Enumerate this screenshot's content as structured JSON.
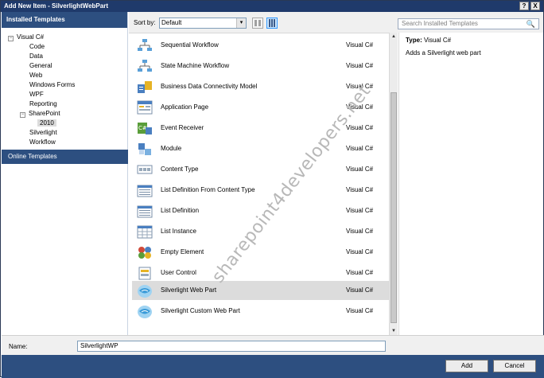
{
  "window": {
    "title": "Add New Item - SilverlightWebPart",
    "help_glyph": "?",
    "close_glyph": "X"
  },
  "left": {
    "header": "Installed Templates",
    "tree": [
      {
        "label": "Visual C#",
        "expander": "−"
      },
      {
        "label": "Code"
      },
      {
        "label": "Data"
      },
      {
        "label": "General"
      },
      {
        "label": "Web"
      },
      {
        "label": "Windows Forms"
      },
      {
        "label": "WPF"
      },
      {
        "label": "Reporting"
      },
      {
        "label": "SharePoint",
        "expander": "−"
      },
      {
        "label": "2010"
      },
      {
        "label": "Silverlight"
      },
      {
        "label": "Workflow"
      }
    ],
    "online": "Online Templates"
  },
  "toolbar": {
    "sort_label": "Sort by:",
    "sort_value": "Default",
    "dropdown_glyph": "▾",
    "search_placeholder": "Search Installed Templates",
    "search_icon": "🔍"
  },
  "templates": [
    {
      "name": "Sequential Workflow",
      "lang": "Visual C#",
      "icon": "workflow-icon"
    },
    {
      "name": "State Machine Workflow",
      "lang": "Visual C#",
      "icon": "workflow-icon"
    },
    {
      "name": "Business Data Connectivity Model",
      "lang": "Visual C#",
      "icon": "bdc-model-icon"
    },
    {
      "name": "Application Page",
      "lang": "Visual C#",
      "icon": "application-page-icon"
    },
    {
      "name": "Event Receiver",
      "lang": "Visual C#",
      "icon": "event-receiver-icon"
    },
    {
      "name": "Module",
      "lang": "Visual C#",
      "icon": "module-icon"
    },
    {
      "name": "Content Type",
      "lang": "Visual C#",
      "icon": "content-type-icon"
    },
    {
      "name": "List Definition From Content Type",
      "lang": "Visual C#",
      "icon": "list-definition-icon"
    },
    {
      "name": "List Definition",
      "lang": "Visual C#",
      "icon": "list-definition-icon"
    },
    {
      "name": "List Instance",
      "lang": "Visual C#",
      "icon": "list-instance-icon"
    },
    {
      "name": "Empty Element",
      "lang": "Visual C#",
      "icon": "empty-element-icon"
    },
    {
      "name": "User Control",
      "lang": "Visual C#",
      "icon": "user-control-icon"
    },
    {
      "name": "Silverlight Web Part",
      "lang": "Visual C#",
      "icon": "silverlight-icon"
    },
    {
      "name": "Silverlight Custom Web Part",
      "lang": "Visual C#",
      "icon": "silverlight-icon"
    }
  ],
  "info": {
    "type_label": "Type:",
    "type_value": "Visual C#",
    "description": "Adds a Silverlight web part"
  },
  "bottom": {
    "name_label": "Name:",
    "name_value": "SilverlightWP",
    "add_label": "Add",
    "cancel_label": "Cancel"
  },
  "watermark": "sharepoint4developers.net",
  "colors": {
    "title_bar": "#1f3a6b",
    "header_blue": "#2d4f80",
    "selection": "#dcdcdc"
  }
}
